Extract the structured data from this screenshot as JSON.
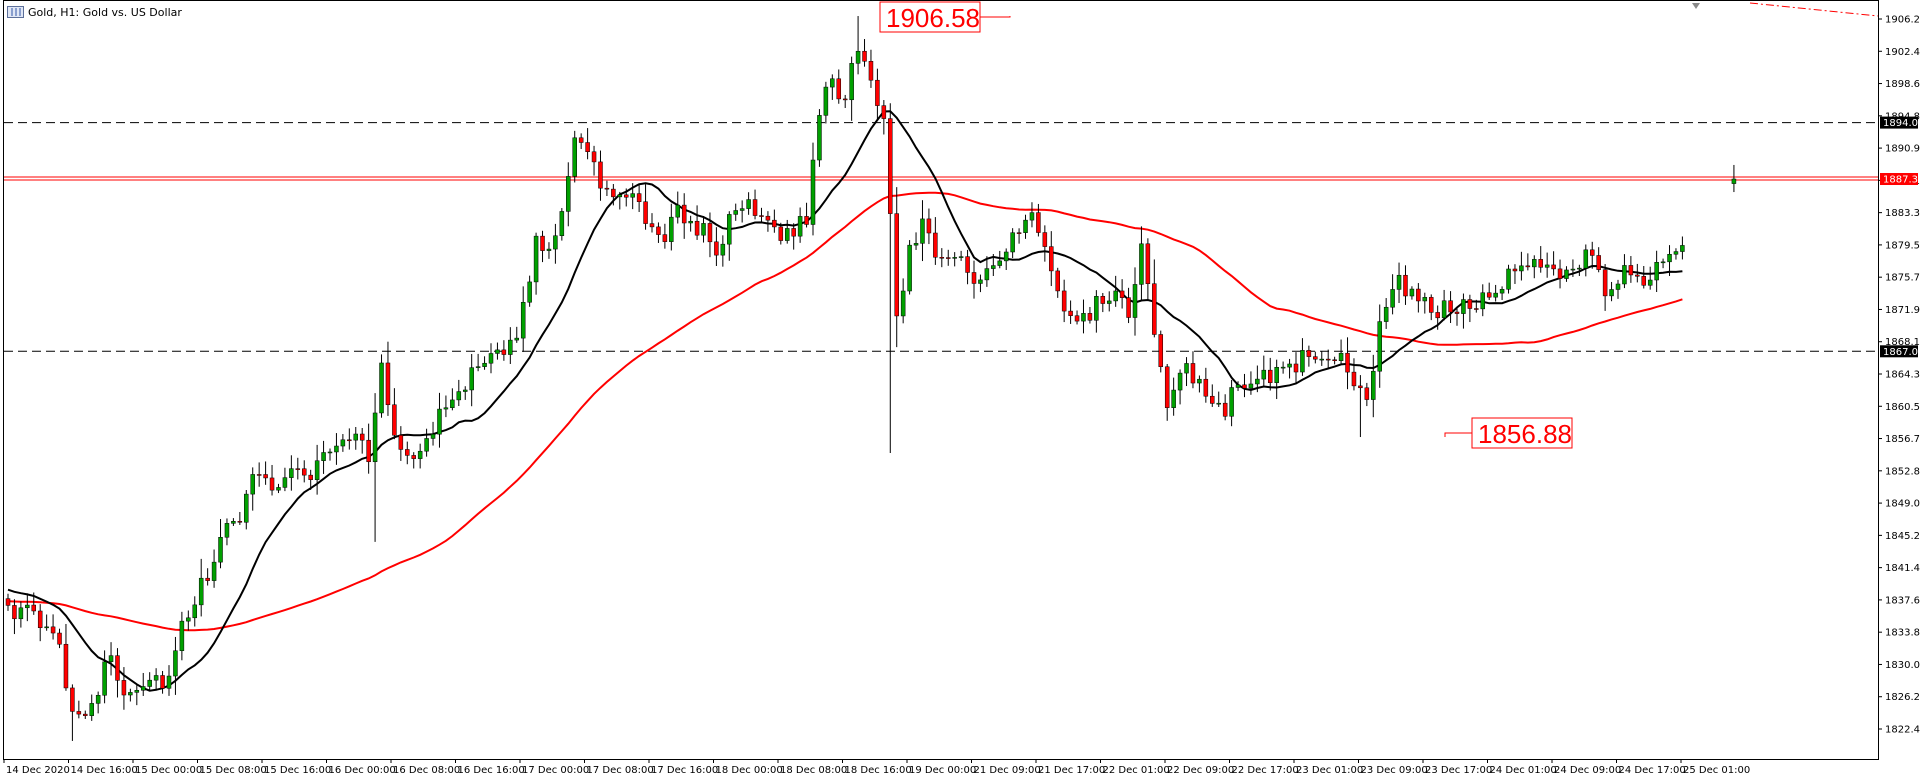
{
  "header": {
    "title": "Gold, H1:  Gold vs. US Dollar",
    "icon": "chart-window-icon"
  },
  "chart_data": {
    "type": "candlestick",
    "symbol": "Gold",
    "timeframe": "H1",
    "description": "Gold vs. US Dollar",
    "grid": false,
    "ylim": [
      1819.5,
      1909.0
    ],
    "y_ticks": [
      "1906.23",
      "1902.42",
      "1898.61",
      "1894.80",
      "1890.99",
      "1887.18",
      "1883.37",
      "1879.56",
      "1875.75",
      "1871.94",
      "1868.13",
      "1864.32",
      "1860.51",
      "1856.70",
      "1852.89",
      "1849.08",
      "1845.27",
      "1841.46",
      "1837.65",
      "1833.84",
      "1830.03",
      "1826.22",
      "1822.41"
    ],
    "x_labels": [
      "14 Dec 2020",
      "14 Dec 16:00",
      "15 Dec 00:00",
      "15 Dec 08:00",
      "15 Dec 16:00",
      "16 Dec 00:00",
      "16 Dec 08:00",
      "16 Dec 16:00",
      "17 Dec 00:00",
      "17 Dec 08:00",
      "17 Dec 16:00",
      "18 Dec 00:00",
      "18 Dec 08:00",
      "18 Dec 16:00",
      "19 Dec 00:00",
      "21 Dec 09:00",
      "21 Dec 17:00",
      "22 Dec 01:00",
      "22 Dec 09:00",
      "22 Dec 17:00",
      "23 Dec 01:00",
      "23 Dec 09:00",
      "23 Dec 17:00",
      "24 Dec 01:00",
      "24 Dec 09:00",
      "24 Dec 17:00",
      "25 Dec 01:00"
    ],
    "levels": [
      {
        "value": 1894.0,
        "label": "1894.00",
        "style": "dashed",
        "color": "#000000"
      },
      {
        "value": 1867.0,
        "label": "1867.00",
        "style": "dashed",
        "color": "#000000"
      },
      {
        "value": 1887.34,
        "label": "1887.34",
        "style": "bid-ask",
        "color": "#ff0000"
      }
    ],
    "annotations": [
      {
        "text": "1906.58",
        "value": 1906.58
      },
      {
        "text": "1856.88",
        "value": 1856.88
      }
    ],
    "colors": {
      "bull": "#00a000",
      "bear": "#ff0000",
      "ma_fast": "#000000",
      "ma_slow": "#ff0000"
    },
    "anchors": [
      [
        0,
        1837.0
      ],
      [
        4,
        1835.5
      ],
      [
        8,
        1832.0
      ],
      [
        10,
        1824.5
      ],
      [
        13,
        1825.5
      ],
      [
        16,
        1831.0
      ],
      [
        18,
        1827.0
      ],
      [
        22,
        1828.5
      ],
      [
        25,
        1828.0
      ],
      [
        27,
        1834.0
      ],
      [
        30,
        1839.0
      ],
      [
        33,
        1844.5
      ],
      [
        36,
        1847.5
      ],
      [
        38,
        1853.5
      ],
      [
        41,
        1851.0
      ],
      [
        44,
        1853.0
      ],
      [
        47,
        1852.5
      ],
      [
        50,
        1855.5
      ],
      [
        53,
        1857.5
      ],
      [
        56,
        1855.0
      ],
      [
        58,
        1864.5
      ],
      [
        60,
        1857.5
      ],
      [
        62,
        1855.0
      ],
      [
        65,
        1855.5
      ],
      [
        68,
        1861.5
      ],
      [
        71,
        1863.5
      ],
      [
        74,
        1865.0
      ],
      [
        77,
        1866.5
      ],
      [
        80,
        1871.5
      ],
      [
        82,
        1880.0
      ],
      [
        84,
        1879.5
      ],
      [
        86,
        1883.5
      ],
      [
        88,
        1893.0
      ],
      [
        90,
        1890.0
      ],
      [
        92,
        1886.5
      ],
      [
        95,
        1885.0
      ],
      [
        98,
        1884.0
      ],
      [
        101,
        1880.0
      ],
      [
        104,
        1883.0
      ],
      [
        107,
        1882.0
      ],
      [
        110,
        1879.0
      ],
      [
        113,
        1883.5
      ],
      [
        115,
        1884.5
      ],
      [
        118,
        1883.0
      ],
      [
        121,
        1880.5
      ],
      [
        124,
        1883.0
      ],
      [
        126,
        1895.0
      ],
      [
        128,
        1899.0
      ],
      [
        130,
        1896.5
      ],
      [
        132,
        1903.5
      ],
      [
        134,
        1898.5
      ],
      [
        136,
        1893.5
      ],
      [
        137,
        1884.0
      ],
      [
        138,
        1871.0
      ],
      [
        140,
        1879.0
      ],
      [
        142,
        1882.5
      ],
      [
        145,
        1877.5
      ],
      [
        148,
        1878.0
      ],
      [
        150,
        1876.0
      ],
      [
        153,
        1877.5
      ],
      [
        156,
        1880.0
      ],
      [
        159,
        1882.5
      ],
      [
        162,
        1877.0
      ],
      [
        164,
        1871.5
      ],
      [
        166,
        1869.5
      ],
      [
        169,
        1872.5
      ],
      [
        172,
        1873.0
      ],
      [
        174,
        1871.5
      ],
      [
        176,
        1878.5
      ],
      [
        178,
        1869.5
      ],
      [
        180,
        1861.5
      ],
      [
        183,
        1864.5
      ],
      [
        186,
        1861.5
      ],
      [
        189,
        1860.5
      ],
      [
        192,
        1863.5
      ],
      [
        195,
        1864.5
      ],
      [
        198,
        1864.0
      ],
      [
        201,
        1866.0
      ],
      [
        204,
        1867.0
      ],
      [
        207,
        1865.5
      ],
      [
        209,
        1864.0
      ],
      [
        211,
        1861.0
      ],
      [
        213,
        1869.5
      ],
      [
        215,
        1875.5
      ],
      [
        218,
        1874.0
      ],
      [
        221,
        1871.5
      ],
      [
        224,
        1872.5
      ],
      [
        227,
        1872.0
      ],
      [
        230,
        1873.0
      ],
      [
        233,
        1875.5
      ],
      [
        236,
        1877.0
      ],
      [
        239,
        1877.5
      ],
      [
        242,
        1876.0
      ],
      [
        245,
        1879.0
      ],
      [
        248,
        1874.0
      ],
      [
        250,
        1875.5
      ],
      [
        252,
        1877.0
      ],
      [
        254,
        1875.5
      ],
      [
        256,
        1877.5
      ],
      [
        258,
        1879.0
      ],
      [
        260,
        1879.5
      ]
    ],
    "gap_bar": 268,
    "last_bar": {
      "open": 1886.8,
      "high": 1889.0,
      "low": 1885.8,
      "close": 1887.34
    },
    "extremes": [
      {
        "bar": 132,
        "high": 1906.58
      },
      {
        "bar": 137,
        "low": 1855.0
      },
      {
        "bar": 210,
        "low": 1856.88
      },
      {
        "bar": 10,
        "low": 1821.0
      },
      {
        "bar": 57,
        "low": 1844.5
      }
    ],
    "ma_fast_period": 14,
    "ma_slow_period": 60,
    "ma_slow_seed": 1837.5
  }
}
